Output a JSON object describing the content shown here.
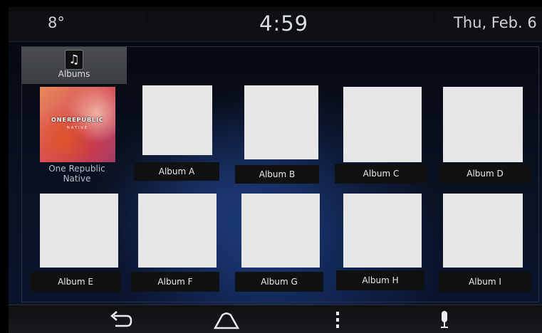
{
  "status": {
    "temperature": "8°",
    "time": "4:59",
    "date": "Thu, Feb. 6"
  },
  "tab": {
    "icon": "music-note-icon",
    "label": "Albums"
  },
  "featured": {
    "art_band": "ONEREPUBLIC",
    "art_sub": "NATIVE",
    "line1": "One Republic",
    "line2": "Native"
  },
  "albums": {
    "a": "Album A",
    "b": "Album B",
    "c": "Album C",
    "d": "Album D",
    "e": "Album E",
    "f": "Album F",
    "g": "Album G",
    "h": "Album H",
    "i": "Album I"
  },
  "nav": {
    "back": "back-icon",
    "home": "home-icon",
    "menu": "more-vertical-icon",
    "voice": "microphone-icon"
  },
  "colors": {
    "placeholder_art": "#e6e6e6",
    "accent_glow": "#2a5ac8"
  }
}
